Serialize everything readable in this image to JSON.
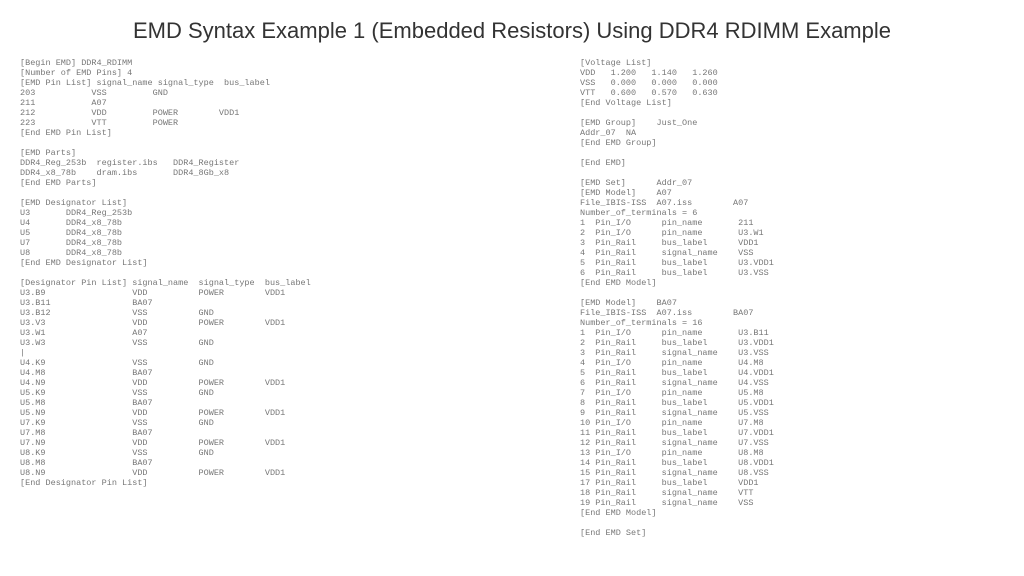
{
  "title": "EMD Syntax Example 1 (Embedded Resistors) Using DDR4 RDIMM Example",
  "left": "[Begin EMD] DDR4_RDIMM\n[Number of EMD Pins] 4\n[EMD Pin List] signal_name signal_type  bus_label\n203           VSS         GND\n211           A07\n212           VDD         POWER        VDD1\n223           VTT         POWER\n[End EMD Pin List]\n\n[EMD Parts]\nDDR4_Reg_253b  register.ibs   DDR4_Register\nDDR4_x8_78b    dram.ibs       DDR4_8Gb_x8\n[End EMD Parts]\n\n[EMD Designator List]\nU3       DDR4_Reg_253b\nU4       DDR4_x8_78b\nU5       DDR4_x8_78b\nU7       DDR4_x8_78b\nU8       DDR4_x8_78b\n[End EMD Designator List]\n\n[Designator Pin List] signal_name  signal_type  bus_label\nU3.B9                 VDD          POWER        VDD1\nU3.B11                BA07\nU3.B12                VSS          GND\nU3.V3                 VDD          POWER        VDD1\nU3.W1                 A07\nU3.W3                 VSS          GND\n|\nU4.K9                 VSS          GND\nU4.M8                 BA07\nU4.N9                 VDD          POWER        VDD1\nU5.K9                 VSS          GND\nU5.M8                 BA07\nU5.N9                 VDD          POWER        VDD1\nU7.K9                 VSS          GND\nU7.M8                 BA07\nU7.N9                 VDD          POWER        VDD1\nU8.K9                 VSS          GND\nU8.M8                 BA07\nU8.N9                 VDD          POWER        VDD1\n[End Designator Pin List]",
  "right": "[Voltage List]\nVDD   1.200   1.140   1.260\nVSS   0.000   0.000   0.000\nVTT   0.600   0.570   0.630\n[End Voltage List]\n\n[EMD Group]    Just_One\nAddr_07  NA\n[End EMD Group]\n\n[End EMD]\n\n[EMD Set]      Addr_07\n[EMD Model]    A07\nFile_IBIS-ISS  A07.iss        A07\nNumber_of_terminals = 6\n1  Pin_I/O      pin_name       211\n2  Pin_I/O      pin_name       U3.W1\n3  Pin_Rail     bus_label      VDD1\n4  Pin_Rail     signal_name    VSS\n5  Pin_Rail     bus_label      U3.VDD1\n6  Pin_Rail     bus_label      U3.VSS\n[End EMD Model]\n\n[EMD Model]    BA07\nFile_IBIS-ISS  A07.iss        BA07\nNumber_of_terminals = 16\n1  Pin_I/O      pin_name       U3.B11\n2  Pin_Rail     bus_label      U3.VDD1\n3  Pin_Rail     signal_name    U3.VSS\n4  Pin_I/O      pin_name       U4.M8\n5  Pin_Rail     bus_label      U4.VDD1\n6  Pin_Rail     signal_name    U4.VSS\n7  Pin_I/O      pin_name       U5.M8\n8  Pin_Rail     bus_label      U5.VDD1\n9  Pin_Rail     signal_name    U5.VSS\n10 Pin_I/O      pin_name       U7.M8\n11 Pin_Rail     bus_label      U7.VDD1\n12 Pin_Rail     signal_name    U7.VSS\n13 Pin_I/O      pin_name       U8.M8\n14 Pin_Rail     bus_label      U8.VDD1\n15 Pin_Rail     signal_name    U8.VSS\n17 Pin_Rail     bus_label      VDD1\n18 Pin_Rail     signal_name    VTT\n19 Pin_Rail     signal_name    VSS\n[End EMD Model]\n\n[End EMD Set]"
}
